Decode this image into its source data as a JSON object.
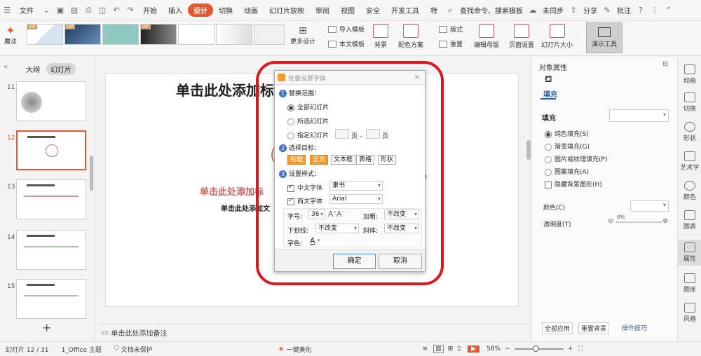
{
  "menubar": {
    "file_label": "文件",
    "tabs": [
      "开始",
      "插入",
      "设计",
      "切换",
      "动画",
      "幻灯片放映",
      "审阅",
      "视图",
      "安全",
      "开发工具",
      "特"
    ],
    "active_tab": "设计",
    "search_placeholder": "查找命令、搜索模板",
    "sync_label": "未同步",
    "share_label": "分享",
    "comment_label": "批注"
  },
  "ribbon": {
    "magic_label": "魔法",
    "more_design_label": "更多设计",
    "import_template_label": "导入模板",
    "this_template_label": "本文模板",
    "background_label": "背景",
    "color_scheme_label": "配色方案",
    "layout_label": "版式",
    "reset_label": "重置",
    "edit_master_label": "编辑母版",
    "page_setup_label": "页面设置",
    "slide_size_label": "幻灯片大小",
    "present_tools_label": "演示工具",
    "vip_badge": "VIP"
  },
  "leftpanel": {
    "tab_outline": "大纲",
    "tab_slides": "幻灯片",
    "slides": [
      {
        "num": "11"
      },
      {
        "num": "12"
      },
      {
        "num": "13"
      },
      {
        "num": "14"
      },
      {
        "num": "15"
      }
    ],
    "add_label": "+"
  },
  "canvas": {
    "title_text": "单击此处添加标",
    "subtitle_text": "单击此处添加标",
    "body_text": "单击此处添加文",
    "notes_placeholder": "单击此处添加备注"
  },
  "dialog": {
    "title": "批量设置字体",
    "section1": "替换范围：",
    "radio_all": "全部幻灯片",
    "radio_selected": "所选幻灯片",
    "radio_specified": "指定幻灯片",
    "page_label": "页 -",
    "page_label2": "页",
    "section2": "选择目标：",
    "targets": [
      "标题",
      "正文",
      "文本框",
      "表格",
      "形状"
    ],
    "section3": "设置样式：",
    "cn_font_label": "中文字体",
    "cn_font_value": "隶书",
    "west_font_label": "西文字体",
    "west_font_value": "Arial",
    "size_label": "字号:",
    "size_value": "36",
    "bold_label": "加粗:",
    "bold_value": "不改变",
    "underline_label": "下划线:",
    "underline_value": "不改变",
    "italic_label": "斜体:",
    "italic_value": "不改变",
    "color_label": "字色:",
    "ok_label": "确定",
    "cancel_label": "取消"
  },
  "rpanel": {
    "header": "对象属性",
    "fill_tab": "填充",
    "fill_section": "填充",
    "fill_options": [
      "纯色填充(S)",
      "渐变填充(G)",
      "图片或纹理填充(P)",
      "图案填充(A)"
    ],
    "hide_bg_label": "隐藏背景图形(H)",
    "color_label": "颜色(C)",
    "transparency_label": "透明度(T)",
    "transparency_value": "0%",
    "all_apply_label": "全部应用",
    "reset_bg_label": "重置背景",
    "op_tips_label": "操作技巧"
  },
  "rtools": [
    "动画",
    "切换",
    "形状",
    "艺术字",
    "颜色",
    "图表",
    "属性",
    "图库",
    "风格"
  ],
  "statusbar": {
    "slide_info": "幻灯片 12 / 31",
    "theme": "1_Office 主题",
    "doc_status": "文档未保护",
    "beautify": "一键美化",
    "zoom": "58%"
  },
  "colors": {
    "accent": "#e8562f",
    "highlight_oval": "#e0161e",
    "target_on": "#f39a2b"
  }
}
